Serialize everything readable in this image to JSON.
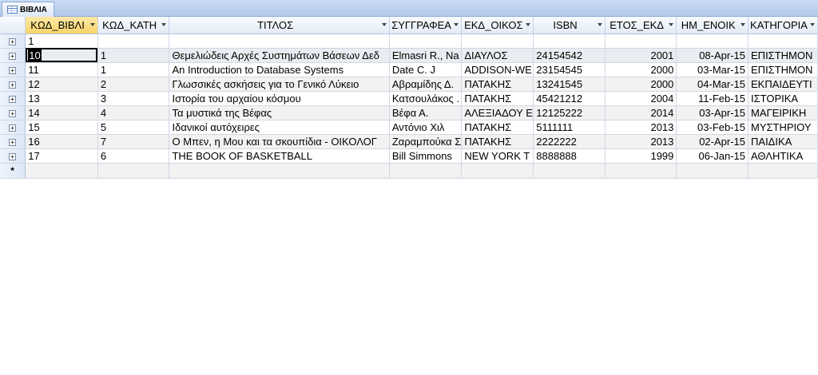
{
  "tab": {
    "title": "ΒΙΒΛΙΑ",
    "icon": "table-icon"
  },
  "columns": [
    {
      "label": "ΚΩΔ_ΒΙΒΛΙ",
      "width": 0
    },
    {
      "label": "ΚΩΔ_ΚΑΤΗ"
    },
    {
      "label": "ΤΙΤΛΟΣ"
    },
    {
      "label": "ΣΥΓΓΡΑΦΕΑ"
    },
    {
      "label": "ΕΚΔ_ΟΙΚΟΣ"
    },
    {
      "label": "ISBN"
    },
    {
      "label": "ΕΤΟΣ_ΕΚΔ"
    },
    {
      "label": "ΗΜ_ΕΝΟΙΚ"
    },
    {
      "label": "ΚΑΤΗΓΟΡΙΑ"
    }
  ],
  "rows": [
    {
      "id": "1",
      "cat_id": "",
      "title": "",
      "author": "",
      "publisher": "",
      "isbn": "",
      "year": "",
      "date": "",
      "category": ""
    },
    {
      "id": "10",
      "cat_id": "1",
      "title": "Θεμελιώδεις Αρχές Συστημάτων Βάσεων Δεδ",
      "author": "Elmasri R., Na",
      "publisher": "ΔΙΑΥΛΟΣ",
      "isbn": "24154542",
      "year": "2001",
      "date": "08-Apr-15",
      "category": "ΕΠΙΣΤΗΜΟΝ"
    },
    {
      "id": "11",
      "cat_id": "1",
      "title": "An Introduction to Database Systems",
      "author": "Date C. J",
      "publisher": "ADDISON-WE",
      "isbn": "23154545",
      "year": "2000",
      "date": "03-Mar-15",
      "category": "ΕΠΙΣΤΗΜΟΝ"
    },
    {
      "id": "12",
      "cat_id": "2",
      "title": "Γλωσσικές ασκήσεις για το Γενικό Λύκειο",
      "author": "Αβραμίδης Δ.",
      "publisher": "ΠΑΤΑΚΗΣ",
      "isbn": "13241545",
      "year": "2000",
      "date": "04-Mar-15",
      "category": "ΕΚΠΑΙΔΕΥΤΙ"
    },
    {
      "id": "13",
      "cat_id": "3",
      "title": "Ιστορία του αρχαίου κόσμου",
      "author": "Κατσουλάκος .",
      "publisher": "ΠΑΤΑΚΗΣ",
      "isbn": "45421212",
      "year": "2004",
      "date": "11-Feb-15",
      "category": "ΙΣΤΟΡΙΚΑ"
    },
    {
      "id": "14",
      "cat_id": "4",
      "title": "Τα μυστικά της Βέφας",
      "author": "Βέφα Α.",
      "publisher": "ΑΛΕΞΙΑΔΟΥ Ε",
      "isbn": "12125222",
      "year": "2014",
      "date": "03-Apr-15",
      "category": "ΜΑΓΕΙΡΙΚΗ"
    },
    {
      "id": "15",
      "cat_id": "5",
      "title": "Ιδανικοί αυτόχειρες",
      "author": "Αντόνιο Χιλ",
      "publisher": "ΠΑΤΑΚΗΣ",
      "isbn": "5111111",
      "year": "2013",
      "date": "03-Feb-15",
      "category": "ΜΥΣΤΗΡΙΟΥ"
    },
    {
      "id": "16",
      "cat_id": "7",
      "title": "Ο Μπεν, η Μου και τα σκουπίδια - ΟΙΚΟΛΟΓ",
      "author": "Ζαραμπούκα Σ",
      "publisher": "ΠΑΤΑΚΗΣ",
      "isbn": "2222222",
      "year": "2013",
      "date": "02-Apr-15",
      "category": "ΠΑΙΔΙΚΑ"
    },
    {
      "id": "17",
      "cat_id": "6",
      "title": "THE BOOK OF BASKETBALL",
      "author": "Bill Simmons",
      "publisher": "NEW YORK T",
      "isbn": "8888888",
      "year": "1999",
      "date": "06-Jan-15",
      "category": "ΑΘΛΗΤΙΚΑ"
    }
  ],
  "new_record_marker": "*",
  "expand_glyph": "+"
}
